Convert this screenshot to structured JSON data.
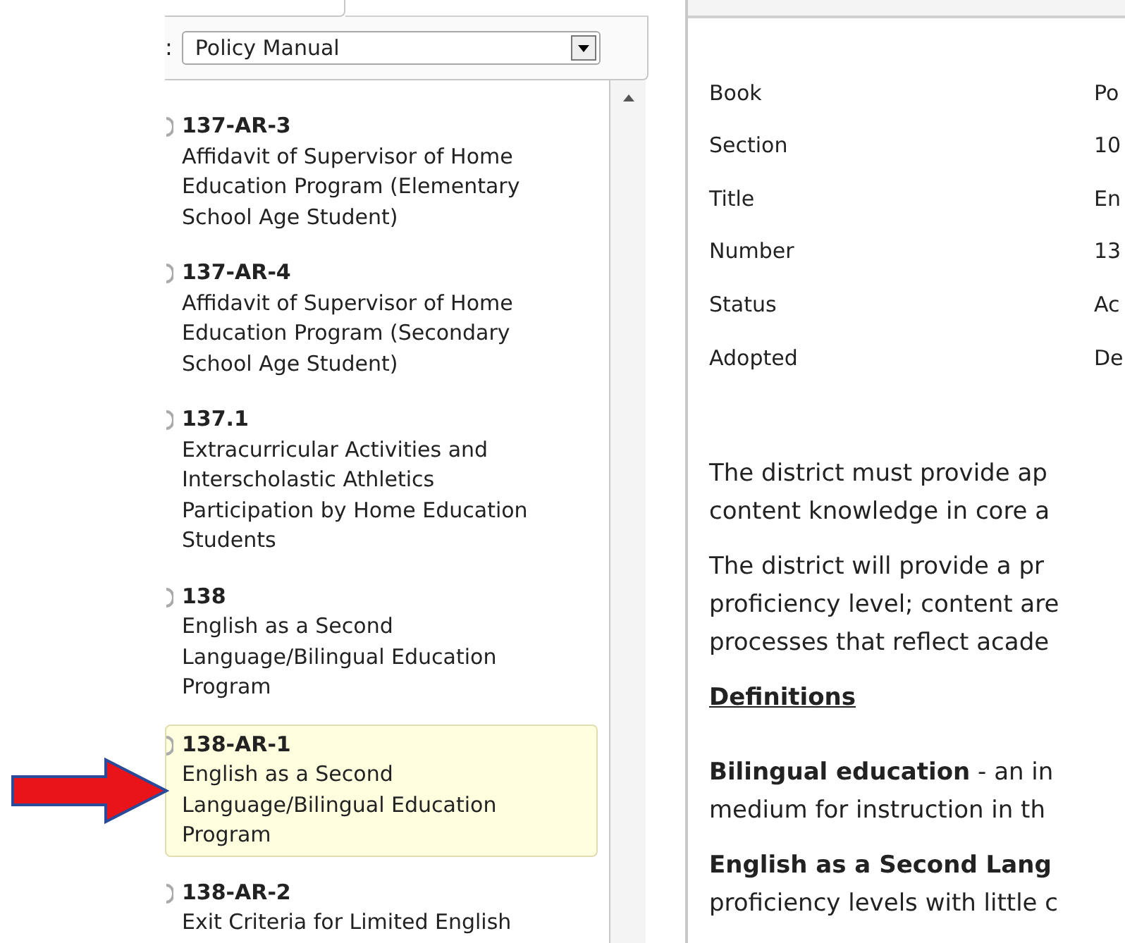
{
  "book_selector": {
    "label": ":",
    "value": "Policy Manual"
  },
  "policies": [
    {
      "number": "137-AR-3",
      "title": "Affidavit of Supervisor of Home Education Program (Elementary School Age Student)",
      "selected": false
    },
    {
      "number": "137-AR-4",
      "title": "Affidavit of Supervisor of Home Education Program (Secondary School Age Student)",
      "selected": false
    },
    {
      "number": "137.1",
      "title": "Extracurricular Activities and Interscholastic Athletics Participation by Home Education Students",
      "selected": false
    },
    {
      "number": "138",
      "title": "English as a Second Language/Bilingual Education Program",
      "selected": false
    },
    {
      "number": "138-AR-1",
      "title": "English as a Second Language/Bilingual Education Program",
      "selected": true
    },
    {
      "number": "138-AR-2",
      "title": "Exit Criteria for Limited English",
      "selected": false
    }
  ],
  "details": [
    {
      "label": "Book",
      "value": "Po"
    },
    {
      "label": "Section",
      "value": "10"
    },
    {
      "label": "Title",
      "value": "En"
    },
    {
      "label": "Number",
      "value": "13"
    },
    {
      "label": "Status",
      "value": "Ac"
    },
    {
      "label": "Adopted",
      "value": "De"
    }
  ],
  "body": [
    {
      "kind": "paragraph",
      "lines": [
        "The district must provide ap",
        "content knowledge in core a"
      ]
    },
    {
      "kind": "paragraph",
      "lines": [
        "The district will provide a pr",
        "proficiency level; content are",
        "processes that reflect acade"
      ]
    },
    {
      "kind": "heading",
      "lines": [
        "Definitions"
      ]
    },
    {
      "kind": "paragraph",
      "lines": [
        "**Bilingual education** - an in",
        "medium for instruction in th"
      ]
    },
    {
      "kind": "paragraph",
      "lines": [
        "**English as a Second Lang**",
        "proficiency levels with little c"
      ]
    }
  ]
}
